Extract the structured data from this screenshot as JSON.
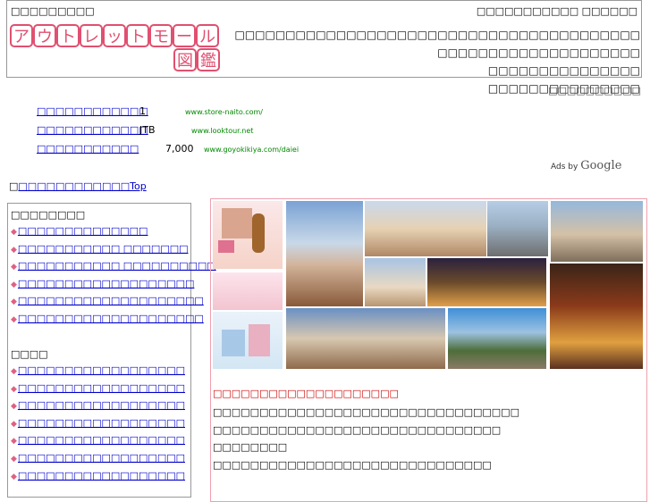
{
  "header": {
    "left_text": "□□□□□□□□□",
    "right_text": "□□□□□□□□□□□ □□□□□□",
    "logo_kana": [
      "ア",
      "ウ",
      "ト",
      "レ",
      "ッ",
      "ト",
      "モ",
      "ー",
      "ル"
    ],
    "logo_kanji": [
      "図",
      "鑑"
    ],
    "body_lines": [
      "□□□□□□□□□□□□□□□□□□□□□□□□□□□□□□□□□□□□□□□□□□□□□□□□□□□□□□□□□□□□",
      "□□□□□□□□□□□□□□□",
      "□□□□□□□□□□□□□□□"
    ]
  },
  "subheader_right": "□□□□□□□□□□",
  "ads": [
    {
      "link": "□□□□□□□□□□□□",
      "desc": "1",
      "url": "www.store-naito.com/"
    },
    {
      "link": "□□□□□□□□□□□□",
      "desc": "JTB",
      "url": "www.looktour.net"
    },
    {
      "link": "□□□□□□□□□□□",
      "desc": "7,000",
      "url": "www.goyokikiya.com/daiei"
    }
  ],
  "ads_by": "Ads by",
  "ads_google": "Google",
  "toplink": {
    "prefix": "□",
    "label": "□□□□□□□□□□□□Top"
  },
  "sidebar": {
    "section1_title": "□□□□□□□□",
    "section1_items": [
      "□□□□□□□□□□□□□□",
      "□□□□□□□□□□□ □□□□□□□",
      "□□□□□□□□□□□ □□□□□□□□□□",
      "□□□□□□□□□□□□□□□□□□□",
      "□□□□□□□□□□□□□□□□□□□□",
      "□□□□□□□□□□□□□□□□□□□□"
    ],
    "section2_title": "□□□□",
    "section2_items": [
      "□□□□□□□□□□□□□□□□□□",
      "□□□□□□□□□□□□□□□□□□",
      "□□□□□□□□□□□□□□□□□□",
      "□□□□□□□□□□□□□□□□□□",
      "□□□□□□□□□□□□□□□□□□",
      "□□□□□□□□□□□□□□□□□□",
      "□□□□□□□□□□□□□□□□□□"
    ]
  },
  "main": {
    "headline": "□□□□□□□□□□□□□□□□□□□□",
    "lines": [
      "□□□□□□□□□□□□□□□□□□□□□□□□□□□□□□□□□",
      "□□□□□□□□□□□□□□□□□□□□□□□□□□□□□□□",
      "□□□□□□□□",
      "□□□□□□□□□□□□□□□□□□□□□□□□□□□□□□"
    ],
    "colors": {
      "headline": "#cc0000",
      "border": "#f0a0b0",
      "logo_pink": "#e05070"
    }
  }
}
